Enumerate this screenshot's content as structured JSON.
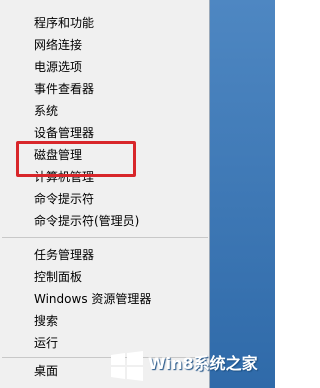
{
  "menu": {
    "items": [
      {
        "label": "程序和功能"
      },
      {
        "label": "网络连接"
      },
      {
        "label": "电源选项"
      },
      {
        "label": "事件查看器"
      },
      {
        "label": "系统"
      },
      {
        "label": "设备管理器"
      },
      {
        "label": "磁盘管理"
      },
      {
        "label": "计算机管理"
      },
      {
        "label": "命令提示符"
      },
      {
        "label": "命令提示符(管理员)"
      },
      {
        "label": "任务管理器"
      },
      {
        "label": "控制面板"
      },
      {
        "label": "Windows 资源管理器"
      },
      {
        "label": "搜索"
      },
      {
        "label": "运行"
      },
      {
        "label": "桌面"
      }
    ],
    "highlighted_item": "磁盘管理",
    "highlight_color": "#d8262a"
  },
  "watermark": {
    "text": "Win8系统之家",
    "logo_icon": "windows-logo-icon"
  },
  "colors": {
    "desktop_background": "#3b79b8",
    "menu_background": "#f0f0f0"
  }
}
